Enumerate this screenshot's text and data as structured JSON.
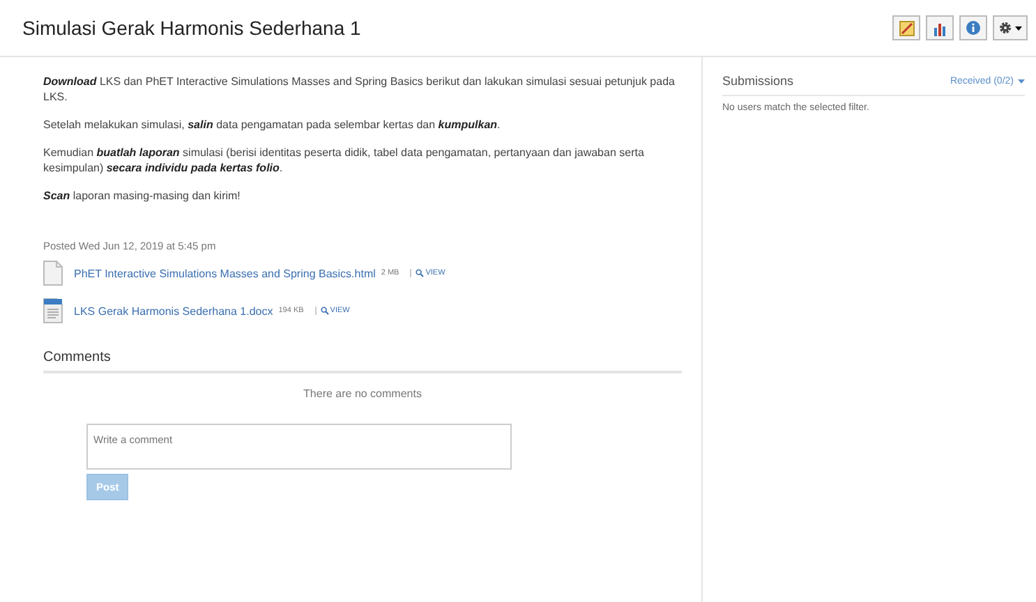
{
  "title": "Simulasi Gerak Harmonis Sederhana 1",
  "paragraphs": [
    "**Download** LKS dan PhET Interactive Simulations Masses and Spring Basics berikut dan lakukan simulasi sesuai petunjuk pada LKS.",
    "Setelah melakukan simulasi, **salin** data pengamatan pada selembar kertas dan **kumpulkan**.",
    "Kemudian **buatlah laporan** simulasi (berisi identitas peserta didik, tabel data pengamatan, pertanyaan dan jawaban serta kesimpulan) **secara individu pada kertas folio**.",
    "**Scan** laporan masing-masing dan kirim!"
  ],
  "posted": "Posted Wed Jun 12, 2019 at 5:45 pm",
  "files": [
    {
      "kind": "blank",
      "name": "PhET Interactive Simulations Masses and Spring Basics.html",
      "size": "2 MB",
      "view": "VIEW"
    },
    {
      "kind": "doc",
      "name": "LKS Gerak Harmonis Sederhana 1.docx",
      "size": "194 KB",
      "view": "VIEW"
    }
  ],
  "comments": {
    "heading": "Comments",
    "empty": "There are no comments",
    "placeholder": "Write a comment",
    "button": {
      "label": "Post",
      "disabled": true
    }
  },
  "submissions": {
    "heading": "Submissions",
    "filter": "Received (0/2)",
    "empty": "No users match the selected filter."
  }
}
